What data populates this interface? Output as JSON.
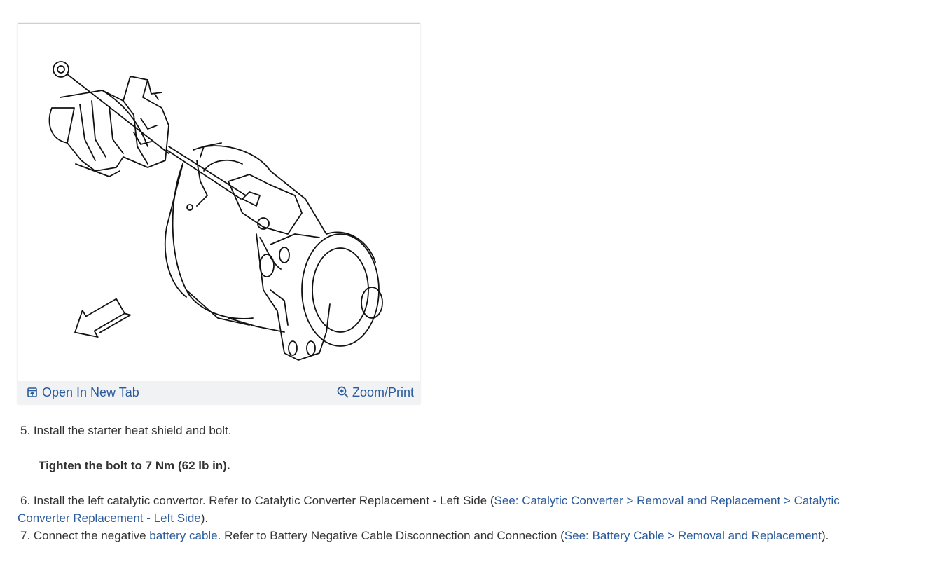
{
  "figure": {
    "open_label": "Open In New Tab",
    "zoom_label": "Zoom/Print"
  },
  "steps": {
    "s5": {
      "text": "5. Install the starter heat shield and bolt."
    },
    "s5_sub": "Tighten the bolt to 7 Nm (62 lb in).",
    "s6": {
      "prefix": "6. Install the left catalytic convertor. Refer to Catalytic Converter Replacement - Left Side (",
      "link": "See: Catalytic Converter > Removal and Replacement > Catalytic Converter Replacement - Left Side",
      "suffix": ")."
    },
    "s7": {
      "prefix": "7. Connect the negative ",
      "link1": "battery cable",
      "middle": ". Refer to Battery Negative Cable Disconnection and Connection (",
      "link2": "See: Battery Cable > Removal and Replacement",
      "suffix": ")."
    }
  },
  "colors": {
    "link": "#2a5b9c",
    "text": "#333333",
    "figbar_bg": "#f1f2f4"
  }
}
